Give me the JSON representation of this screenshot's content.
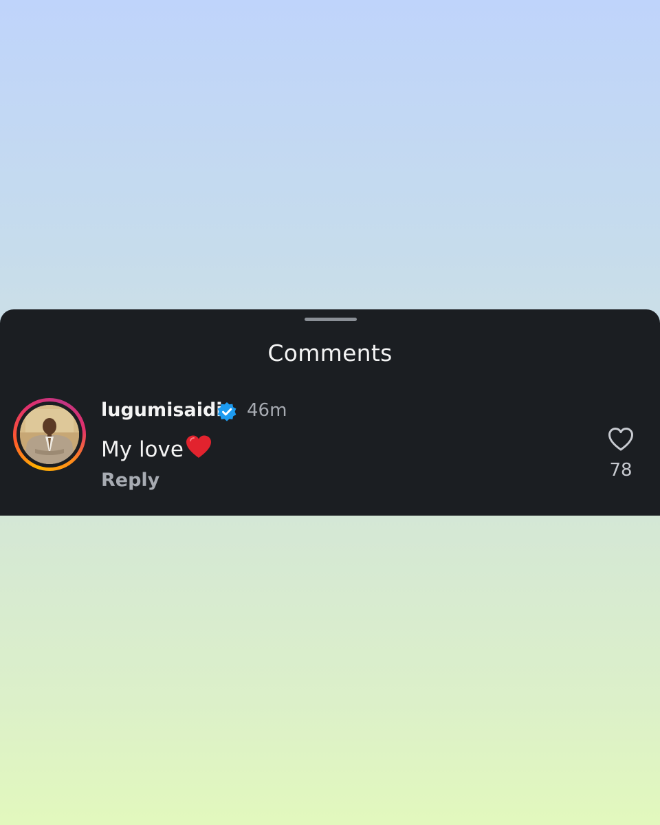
{
  "sheet": {
    "title": "Comments"
  },
  "comment": {
    "username": "lugumisaidi",
    "verified": true,
    "time": "46m",
    "text": "My love",
    "reply_label": "Reply",
    "like_count": "78"
  },
  "icons": {
    "verified": "verified-badge-icon",
    "emoji": "red-heart-emoji",
    "like": "heart-outline-icon"
  },
  "colors": {
    "sheet_background": "#1b1e22",
    "verified_blue": "#1d9bf0",
    "muted_text": "#a7abb2",
    "emoji_red": "#e2232e"
  }
}
